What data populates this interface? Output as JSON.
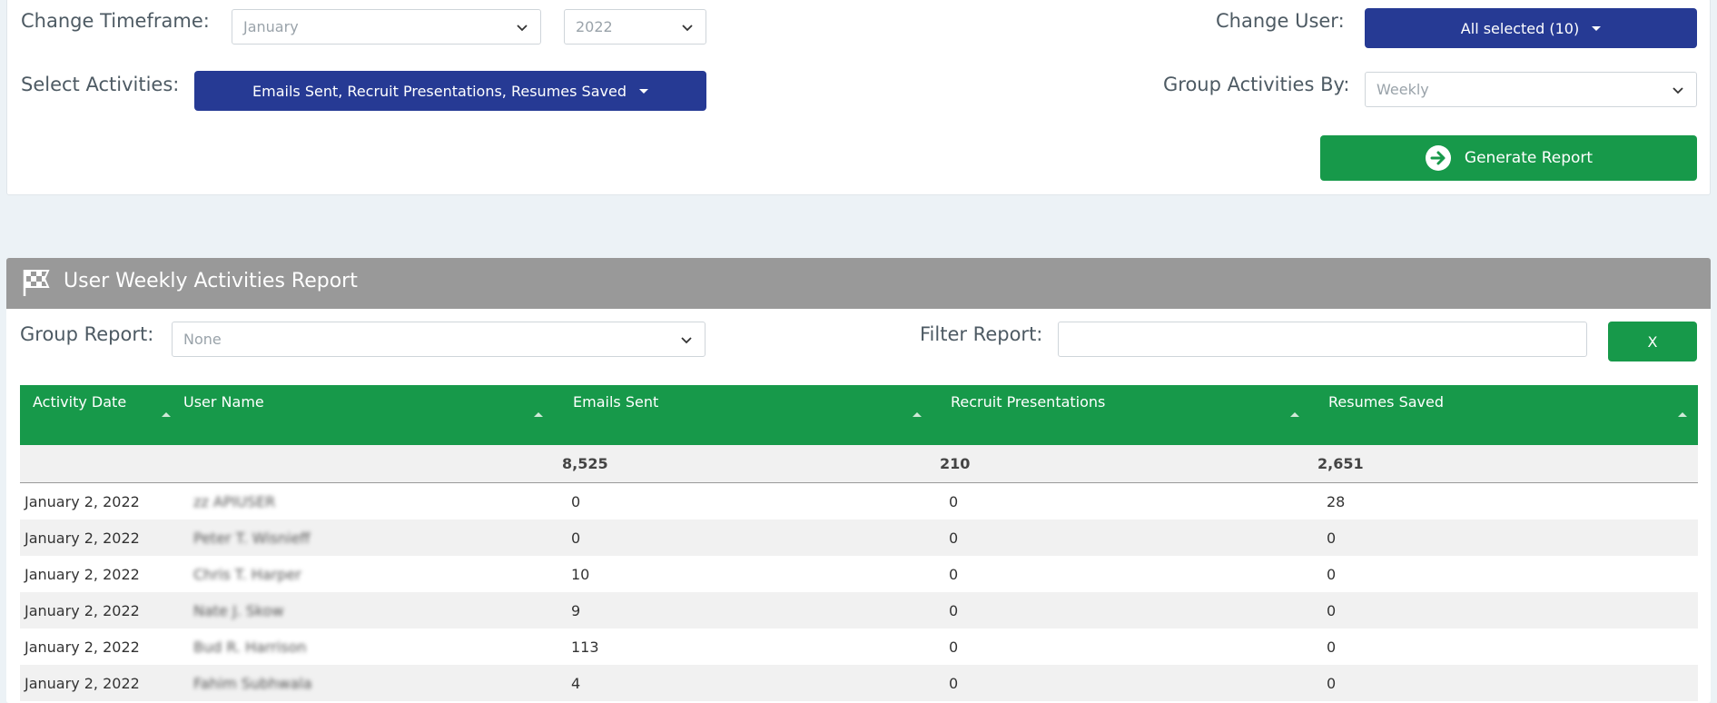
{
  "filters": {
    "timeframe_label": "Change Timeframe:",
    "month_value": "January",
    "year_value": "2022",
    "user_label": "Change User:",
    "user_button": "All selected (10)",
    "activities_label": "Select Activities:",
    "activities_button": "Emails Sent, Recruit Presentations, Resumes Saved",
    "group_by_label": "Group Activities By:",
    "group_by_value": "Weekly",
    "generate_button": "Generate Report"
  },
  "report": {
    "title": "User Weekly Activities Report",
    "group_label": "Group Report:",
    "group_value": "None",
    "filter_label": "Filter Report:",
    "filter_value": "",
    "clear_button": "X",
    "columns": [
      "Activity Date",
      "User Name",
      "Emails Sent",
      "Recruit Presentations",
      "Resumes Saved"
    ],
    "totals": {
      "emails": "8,525",
      "presentations": "210",
      "resumes": "2,651"
    },
    "rows": [
      {
        "date": "January 2, 2022",
        "user": "zz APIUSER",
        "emails": "0",
        "presentations": "0",
        "resumes": "28"
      },
      {
        "date": "January 2, 2022",
        "user": "Peter T. Wisnieff",
        "emails": "0",
        "presentations": "0",
        "resumes": "0"
      },
      {
        "date": "January 2, 2022",
        "user": "Chris T. Harper",
        "emails": "10",
        "presentations": "0",
        "resumes": "0"
      },
      {
        "date": "January 2, 2022",
        "user": "Nate J. Skow",
        "emails": "9",
        "presentations": "0",
        "resumes": "0"
      },
      {
        "date": "January 2, 2022",
        "user": "Bud R. Harrison",
        "emails": "113",
        "presentations": "0",
        "resumes": "0"
      },
      {
        "date": "January 2, 2022",
        "user": "Fahim Subhwala",
        "emails": "4",
        "presentations": "0",
        "resumes": "0"
      }
    ]
  },
  "colors": {
    "primary_blue": "#263a94",
    "primary_green": "#17994a",
    "header_gray": "#999999",
    "page_background": "#ecf2f6"
  }
}
